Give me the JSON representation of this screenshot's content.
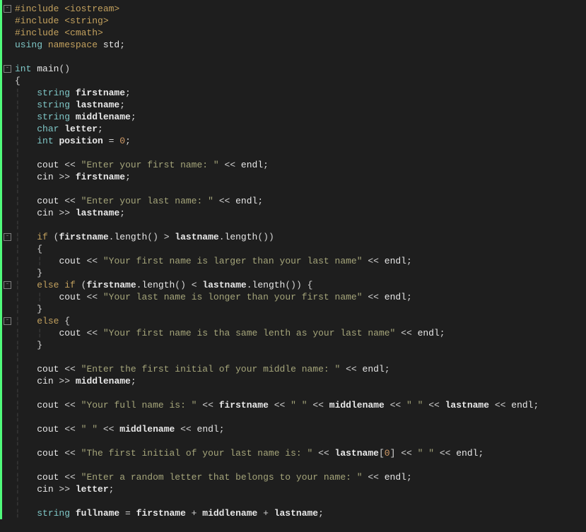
{
  "code": {
    "lines": [
      {
        "indent": 0,
        "fold": true,
        "tokens": [
          {
            "t": "#include ",
            "c": "kw-preproc"
          },
          {
            "t": "<iostream>",
            "c": "string-angle"
          }
        ]
      },
      {
        "indent": 0,
        "tokens": [
          {
            "t": "#include ",
            "c": "kw-preproc"
          },
          {
            "t": "<string>",
            "c": "string-angle"
          }
        ]
      },
      {
        "indent": 0,
        "tokens": [
          {
            "t": "#include ",
            "c": "kw-preproc"
          },
          {
            "t": "<cmath>",
            "c": "string-angle"
          }
        ]
      },
      {
        "indent": 0,
        "tokens": [
          {
            "t": "using ",
            "c": "kw-keyword"
          },
          {
            "t": "namespace ",
            "c": "namespace"
          },
          {
            "t": "std",
            "c": "std"
          },
          {
            "t": ";",
            "c": "punct"
          }
        ]
      },
      {
        "indent": 0,
        "tokens": []
      },
      {
        "indent": 0,
        "fold": true,
        "tokens": [
          {
            "t": "int ",
            "c": "kw-type"
          },
          {
            "t": "main",
            "c": "func"
          },
          {
            "t": "()",
            "c": "brace"
          }
        ]
      },
      {
        "indent": 0,
        "tokens": [
          {
            "t": "{",
            "c": "brace"
          }
        ]
      },
      {
        "indent": 1,
        "tokens": [
          {
            "t": "string ",
            "c": "kw-type"
          },
          {
            "t": "firstname",
            "c": "firstname"
          },
          {
            "t": ";",
            "c": "punct"
          }
        ]
      },
      {
        "indent": 1,
        "tokens": [
          {
            "t": "string ",
            "c": "kw-type"
          },
          {
            "t": "lastname",
            "c": "firstname"
          },
          {
            "t": ";",
            "c": "punct"
          }
        ]
      },
      {
        "indent": 1,
        "tokens": [
          {
            "t": "string ",
            "c": "kw-type"
          },
          {
            "t": "middlename",
            "c": "firstname"
          },
          {
            "t": ";",
            "c": "punct"
          }
        ]
      },
      {
        "indent": 1,
        "tokens": [
          {
            "t": "char ",
            "c": "kw-type"
          },
          {
            "t": "letter",
            "c": "firstname"
          },
          {
            "t": ";",
            "c": "punct"
          }
        ]
      },
      {
        "indent": 1,
        "tokens": [
          {
            "t": "int ",
            "c": "kw-type"
          },
          {
            "t": "position",
            "c": "firstname"
          },
          {
            "t": " = ",
            "c": "op"
          },
          {
            "t": "0",
            "c": "number"
          },
          {
            "t": ";",
            "c": "punct"
          }
        ]
      },
      {
        "indent": 1,
        "tokens": []
      },
      {
        "indent": 1,
        "tokens": [
          {
            "t": "cout",
            "c": "ident"
          },
          {
            "t": " << ",
            "c": "op"
          },
          {
            "t": "\"Enter your first name: \"",
            "c": "string"
          },
          {
            "t": " << ",
            "c": "op"
          },
          {
            "t": "endl",
            "c": "endl"
          },
          {
            "t": ";",
            "c": "punct"
          }
        ]
      },
      {
        "indent": 1,
        "tokens": [
          {
            "t": "cin",
            "c": "ident"
          },
          {
            "t": " >> ",
            "c": "op"
          },
          {
            "t": "firstname",
            "c": "firstname"
          },
          {
            "t": ";",
            "c": "punct"
          }
        ]
      },
      {
        "indent": 1,
        "tokens": []
      },
      {
        "indent": 1,
        "tokens": [
          {
            "t": "cout",
            "c": "ident"
          },
          {
            "t": " << ",
            "c": "op"
          },
          {
            "t": "\"Enter your last name: \"",
            "c": "string"
          },
          {
            "t": " << ",
            "c": "op"
          },
          {
            "t": "endl",
            "c": "endl"
          },
          {
            "t": ";",
            "c": "punct"
          }
        ]
      },
      {
        "indent": 1,
        "tokens": [
          {
            "t": "cin",
            "c": "ident"
          },
          {
            "t": " >> ",
            "c": "op"
          },
          {
            "t": "lastname",
            "c": "firstname"
          },
          {
            "t": ";",
            "c": "punct"
          }
        ]
      },
      {
        "indent": 1,
        "tokens": []
      },
      {
        "indent": 1,
        "fold": true,
        "tokens": [
          {
            "t": "if ",
            "c": "kw-flow"
          },
          {
            "t": "(",
            "c": "brace"
          },
          {
            "t": "firstname",
            "c": "firstname"
          },
          {
            "t": ".",
            "c": "punct"
          },
          {
            "t": "length",
            "c": "func"
          },
          {
            "t": "()",
            "c": "brace"
          },
          {
            "t": " > ",
            "c": "op"
          },
          {
            "t": "lastname",
            "c": "firstname"
          },
          {
            "t": ".",
            "c": "punct"
          },
          {
            "t": "length",
            "c": "func"
          },
          {
            "t": "()",
            "c": "brace"
          },
          {
            "t": ")",
            "c": "brace"
          }
        ]
      },
      {
        "indent": 1,
        "tokens": [
          {
            "t": "{",
            "c": "brace"
          }
        ]
      },
      {
        "indent": 2,
        "tokens": [
          {
            "t": "cout",
            "c": "ident"
          },
          {
            "t": " << ",
            "c": "op"
          },
          {
            "t": "\"Your first name is larger than your last name\"",
            "c": "string"
          },
          {
            "t": " << ",
            "c": "op"
          },
          {
            "t": "endl",
            "c": "endl"
          },
          {
            "t": ";",
            "c": "punct"
          }
        ]
      },
      {
        "indent": 1,
        "tokens": [
          {
            "t": "}",
            "c": "brace"
          }
        ]
      },
      {
        "indent": 1,
        "fold": true,
        "tokens": [
          {
            "t": "else if ",
            "c": "kw-flow"
          },
          {
            "t": "(",
            "c": "brace"
          },
          {
            "t": "firstname",
            "c": "firstname"
          },
          {
            "t": ".",
            "c": "punct"
          },
          {
            "t": "length",
            "c": "func"
          },
          {
            "t": "()",
            "c": "brace"
          },
          {
            "t": " < ",
            "c": "op"
          },
          {
            "t": "lastname",
            "c": "firstname"
          },
          {
            "t": ".",
            "c": "punct"
          },
          {
            "t": "length",
            "c": "func"
          },
          {
            "t": "()",
            "c": "brace"
          },
          {
            "t": ") {",
            "c": "brace"
          }
        ]
      },
      {
        "indent": 2,
        "tokens": [
          {
            "t": "cout",
            "c": "ident"
          },
          {
            "t": " << ",
            "c": "op"
          },
          {
            "t": "\"Your last name is longer than your first name\"",
            "c": "string"
          },
          {
            "t": " << ",
            "c": "op"
          },
          {
            "t": "endl",
            "c": "endl"
          },
          {
            "t": ";",
            "c": "punct"
          }
        ]
      },
      {
        "indent": 1,
        "tokens": [
          {
            "t": "}",
            "c": "brace"
          }
        ]
      },
      {
        "indent": 1,
        "fold": true,
        "tokens": [
          {
            "t": "else ",
            "c": "kw-flow"
          },
          {
            "t": "{",
            "c": "brace"
          }
        ]
      },
      {
        "indent": 2,
        "tokens": [
          {
            "t": "cout",
            "c": "ident"
          },
          {
            "t": " << ",
            "c": "op"
          },
          {
            "t": "\"Your first name is tha same lenth as your last name\"",
            "c": "string"
          },
          {
            "t": " << ",
            "c": "op"
          },
          {
            "t": "endl",
            "c": "endl"
          },
          {
            "t": ";",
            "c": "punct"
          }
        ]
      },
      {
        "indent": 1,
        "tokens": [
          {
            "t": "}",
            "c": "brace"
          }
        ]
      },
      {
        "indent": 1,
        "tokens": []
      },
      {
        "indent": 1,
        "tokens": [
          {
            "t": "cout",
            "c": "ident"
          },
          {
            "t": " << ",
            "c": "op"
          },
          {
            "t": "\"Enter the first initial of your middle name: \"",
            "c": "string"
          },
          {
            "t": " << ",
            "c": "op"
          },
          {
            "t": "endl",
            "c": "endl"
          },
          {
            "t": ";",
            "c": "punct"
          }
        ]
      },
      {
        "indent": 1,
        "tokens": [
          {
            "t": "cin",
            "c": "ident"
          },
          {
            "t": " >> ",
            "c": "op"
          },
          {
            "t": "middlename",
            "c": "firstname"
          },
          {
            "t": ";",
            "c": "punct"
          }
        ]
      },
      {
        "indent": 1,
        "tokens": []
      },
      {
        "indent": 1,
        "tokens": [
          {
            "t": "cout",
            "c": "ident"
          },
          {
            "t": " << ",
            "c": "op"
          },
          {
            "t": "\"Your full name is: \"",
            "c": "string"
          },
          {
            "t": " << ",
            "c": "op"
          },
          {
            "t": "firstname",
            "c": "firstname"
          },
          {
            "t": " << ",
            "c": "op"
          },
          {
            "t": "\" \"",
            "c": "string"
          },
          {
            "t": " << ",
            "c": "op"
          },
          {
            "t": "middlename",
            "c": "firstname"
          },
          {
            "t": " << ",
            "c": "op"
          },
          {
            "t": "\" \"",
            "c": "string"
          },
          {
            "t": " << ",
            "c": "op"
          },
          {
            "t": "lastname",
            "c": "firstname"
          },
          {
            "t": " << ",
            "c": "op"
          },
          {
            "t": "endl",
            "c": "endl"
          },
          {
            "t": ";",
            "c": "punct"
          }
        ]
      },
      {
        "indent": 1,
        "tokens": []
      },
      {
        "indent": 1,
        "tokens": [
          {
            "t": "cout",
            "c": "ident"
          },
          {
            "t": " << ",
            "c": "op"
          },
          {
            "t": "\" \"",
            "c": "string"
          },
          {
            "t": " << ",
            "c": "op"
          },
          {
            "t": "middlename",
            "c": "firstname"
          },
          {
            "t": " << ",
            "c": "op"
          },
          {
            "t": "endl",
            "c": "endl"
          },
          {
            "t": ";",
            "c": "punct"
          }
        ]
      },
      {
        "indent": 1,
        "tokens": []
      },
      {
        "indent": 1,
        "tokens": [
          {
            "t": "cout",
            "c": "ident"
          },
          {
            "t": " << ",
            "c": "op"
          },
          {
            "t": "\"The first initial of your last name is: \"",
            "c": "string"
          },
          {
            "t": " << ",
            "c": "op"
          },
          {
            "t": "lastname",
            "c": "firstname"
          },
          {
            "t": "[",
            "c": "brace"
          },
          {
            "t": "0",
            "c": "number"
          },
          {
            "t": "]",
            "c": "brace"
          },
          {
            "t": " << ",
            "c": "op"
          },
          {
            "t": "\" \"",
            "c": "string"
          },
          {
            "t": " << ",
            "c": "op"
          },
          {
            "t": "endl",
            "c": "endl"
          },
          {
            "t": ";",
            "c": "punct"
          }
        ]
      },
      {
        "indent": 1,
        "tokens": []
      },
      {
        "indent": 1,
        "tokens": [
          {
            "t": "cout",
            "c": "ident"
          },
          {
            "t": " << ",
            "c": "op"
          },
          {
            "t": "\"Enter a random letter that belongs to your name: \"",
            "c": "string"
          },
          {
            "t": " << ",
            "c": "op"
          },
          {
            "t": "endl",
            "c": "endl"
          },
          {
            "t": ";",
            "c": "punct"
          }
        ]
      },
      {
        "indent": 1,
        "tokens": [
          {
            "t": "cin",
            "c": "ident"
          },
          {
            "t": " >> ",
            "c": "op"
          },
          {
            "t": "letter",
            "c": "firstname"
          },
          {
            "t": ";",
            "c": "punct"
          }
        ]
      },
      {
        "indent": 1,
        "tokens": []
      },
      {
        "indent": 1,
        "tokens": [
          {
            "t": "string ",
            "c": "kw-type"
          },
          {
            "t": "fullname",
            "c": "firstname"
          },
          {
            "t": " = ",
            "c": "op"
          },
          {
            "t": "firstname",
            "c": "firstname"
          },
          {
            "t": " + ",
            "c": "op"
          },
          {
            "t": "middlename",
            "c": "firstname"
          },
          {
            "t": " + ",
            "c": "op"
          },
          {
            "t": "lastname",
            "c": "firstname"
          },
          {
            "t": ";",
            "c": "punct"
          }
        ]
      }
    ]
  }
}
